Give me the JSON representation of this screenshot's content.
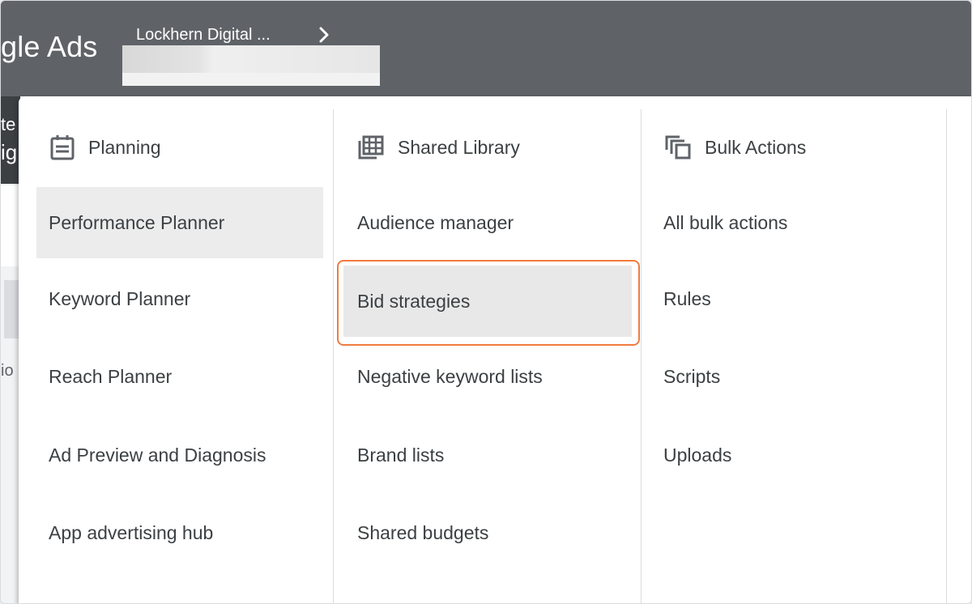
{
  "header": {
    "logo_text": "gle Ads",
    "account_name": "Lockhern Digital ...",
    "chevron_icon": "chevron-right-icon"
  },
  "background": {
    "peek_te": "te",
    "peek_ig": "ig",
    "peek_io": "io"
  },
  "menu": {
    "planning": {
      "title": "Planning",
      "icon": "calendar-icon",
      "items": [
        {
          "label": "Performance Planner"
        },
        {
          "label": "Keyword Planner"
        },
        {
          "label": "Reach Planner"
        },
        {
          "label": "Ad Preview and Diagnosis"
        },
        {
          "label": "App advertising hub"
        }
      ]
    },
    "shared_library": {
      "title": "Shared Library",
      "icon": "library-grid-icon",
      "items": [
        {
          "label": "Audience manager"
        },
        {
          "label": "Bid strategies"
        },
        {
          "label": "Negative keyword lists"
        },
        {
          "label": "Brand lists"
        },
        {
          "label": "Shared budgets"
        }
      ]
    },
    "bulk_actions": {
      "title": "Bulk Actions",
      "icon": "copy-stack-icon",
      "items": [
        {
          "label": "All bulk actions"
        },
        {
          "label": "Rules"
        },
        {
          "label": "Scripts"
        },
        {
          "label": "Uploads"
        }
      ]
    }
  },
  "colors": {
    "header_bg": "#5f6368",
    "highlight_ring": "#f07b3f",
    "hover_bg": "#ececec"
  }
}
